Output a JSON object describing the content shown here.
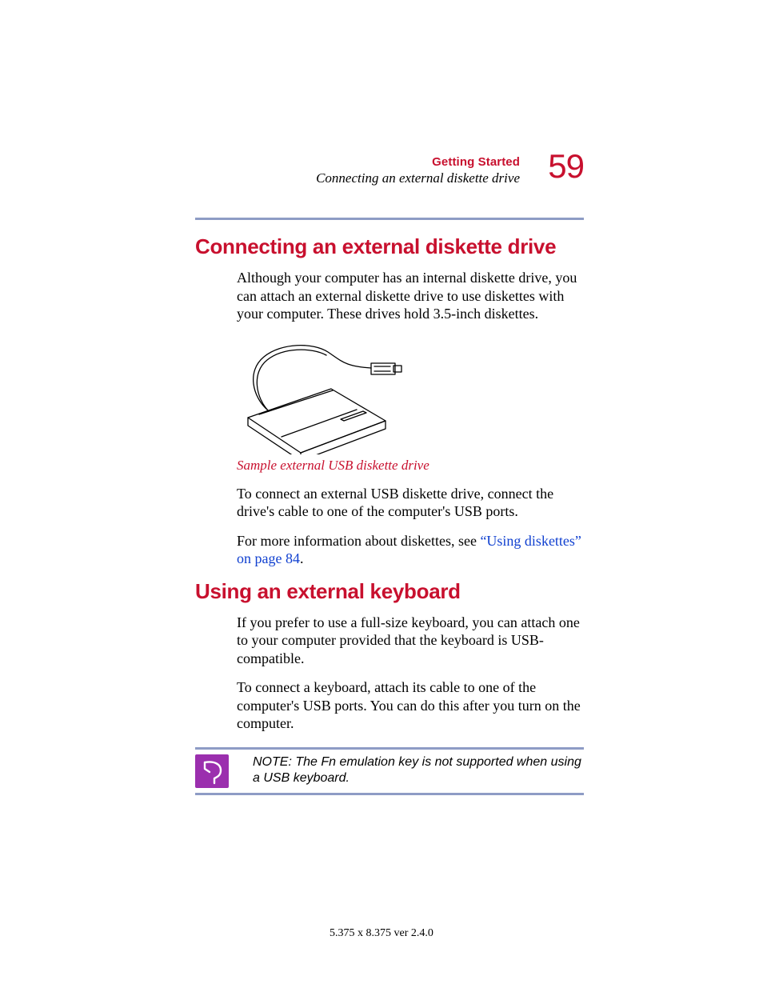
{
  "header": {
    "chapter": "Getting Started",
    "section": "Connecting an external diskette drive",
    "page_number": "59"
  },
  "sections": {
    "s1": {
      "title": "Connecting an external diskette drive",
      "p1": "Although your computer has an internal diskette drive, you can attach an external diskette drive to use diskettes with your computer. These drives hold 3.5-inch diskettes.",
      "caption": "Sample external USB diskette drive",
      "p2": "To connect an external USB diskette drive, connect the drive's cable to one of the computer's USB ports.",
      "p3_a": "For more information about diskettes, see ",
      "p3_link": "“Using diskettes” on page 84",
      "p3_b": "."
    },
    "s2": {
      "title": "Using an external keyboard",
      "p1": "If you prefer to use a full-size keyboard, you can attach one to your computer provided that the keyboard is USB-compatible.",
      "p2": "To connect a keyboard, attach its cable to one of the computer's USB ports. You can do this after you turn on the computer."
    }
  },
  "note": {
    "text": "NOTE: The Fn emulation key is not supported when using a USB keyboard."
  },
  "footer": "5.375 x 8.375 ver 2.4.0"
}
